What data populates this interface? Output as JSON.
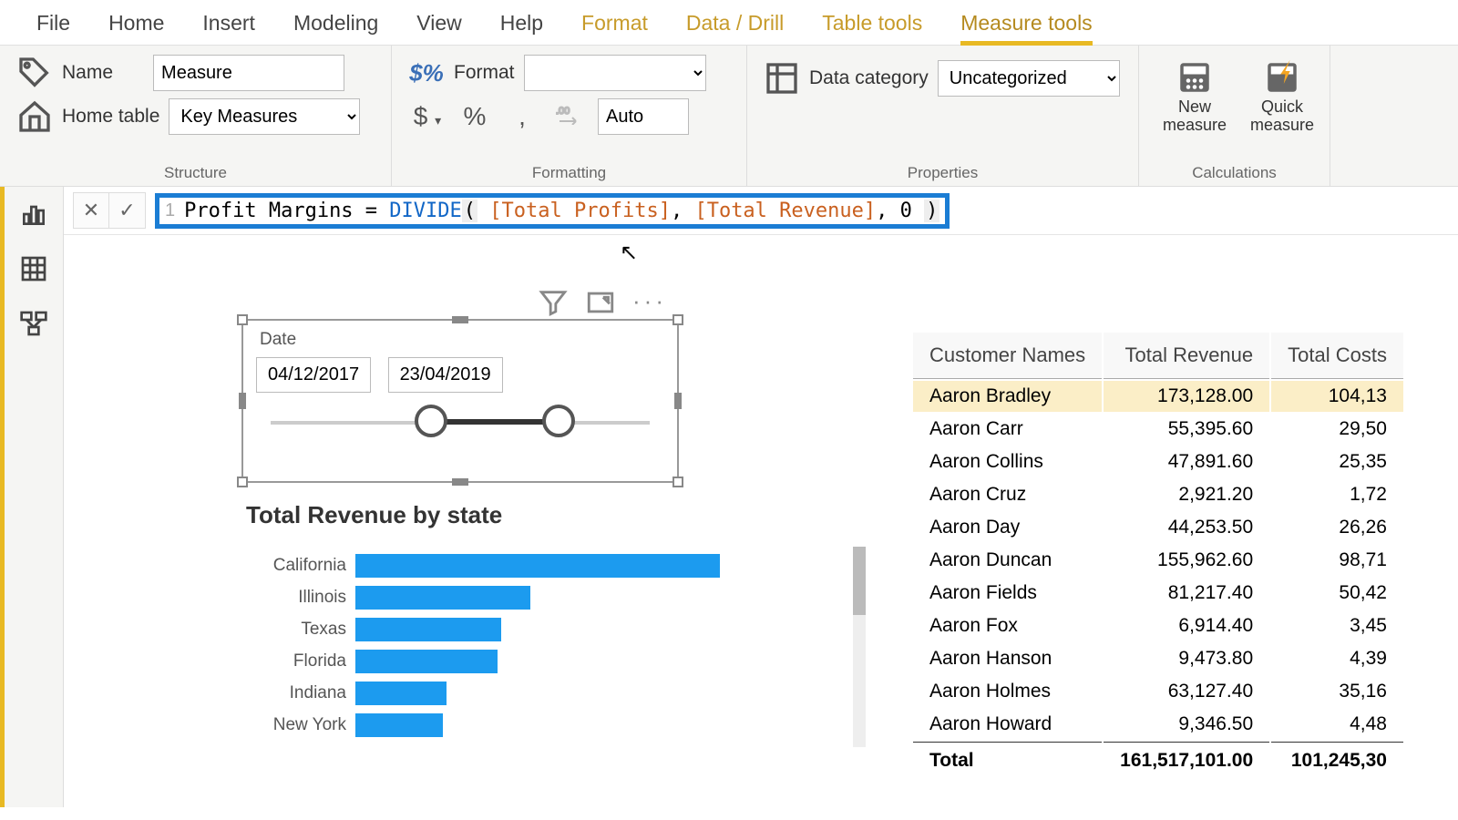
{
  "tabs": {
    "file": "File",
    "home": "Home",
    "insert": "Insert",
    "modeling": "Modeling",
    "view": "View",
    "help": "Help",
    "format": "Format",
    "datadrill": "Data / Drill",
    "tabletools": "Table tools",
    "measuretools": "Measure tools"
  },
  "structure": {
    "name_label": "Name",
    "name_value": "Measure",
    "home_table_label": "Home table",
    "home_table_value": "Key Measures",
    "group": "Structure"
  },
  "formatting": {
    "format_label": "Format",
    "format_value": "",
    "auto": "Auto",
    "group": "Formatting"
  },
  "properties": {
    "datacat_label": "Data category",
    "datacat_value": "Uncategorized",
    "group": "Properties"
  },
  "calculations": {
    "new": "New measure",
    "quick": "Quick measure",
    "group": "Calculations"
  },
  "formula": {
    "line": "1",
    "pre": "Profit Margins = ",
    "fn": "DIVIDE",
    "open": "(",
    "ref1": " [Total Profits]",
    "c1": ", ",
    "ref2": "[Total Revenue]",
    "c2": ", 0 ",
    "close": ")"
  },
  "slicer": {
    "title": "Date",
    "start": "04/12/2017",
    "end": "23/04/2019"
  },
  "chart_data": {
    "type": "bar",
    "title": "Total Revenue by state",
    "categories": [
      "California",
      "Illinois",
      "Texas",
      "Florida",
      "Indiana",
      "New York"
    ],
    "values": [
      100,
      48,
      40,
      39,
      25,
      24
    ],
    "xlabel": "",
    "ylabel": "",
    "ylim": [
      0,
      100
    ]
  },
  "table": {
    "headers": [
      "Customer Names",
      "Total Revenue",
      "Total Costs"
    ],
    "rows": [
      {
        "n": "Aaron Bradley",
        "r": "173,128.00",
        "c": "104,13"
      },
      {
        "n": "Aaron Carr",
        "r": "55,395.60",
        "c": "29,50"
      },
      {
        "n": "Aaron Collins",
        "r": "47,891.60",
        "c": "25,35"
      },
      {
        "n": "Aaron Cruz",
        "r": "2,921.20",
        "c": "1,72"
      },
      {
        "n": "Aaron Day",
        "r": "44,253.50",
        "c": "26,26"
      },
      {
        "n": "Aaron Duncan",
        "r": "155,962.60",
        "c": "98,71"
      },
      {
        "n": "Aaron Fields",
        "r": "81,217.40",
        "c": "50,42"
      },
      {
        "n": "Aaron Fox",
        "r": "6,914.40",
        "c": "3,45"
      },
      {
        "n": "Aaron Hanson",
        "r": "9,473.80",
        "c": "4,39"
      },
      {
        "n": "Aaron Holmes",
        "r": "63,127.40",
        "c": "35,16"
      },
      {
        "n": "Aaron Howard",
        "r": "9,346.50",
        "c": "4,48"
      }
    ],
    "total_label": "Total",
    "total_r": "161,517,101.00",
    "total_c": "101,245,30"
  }
}
